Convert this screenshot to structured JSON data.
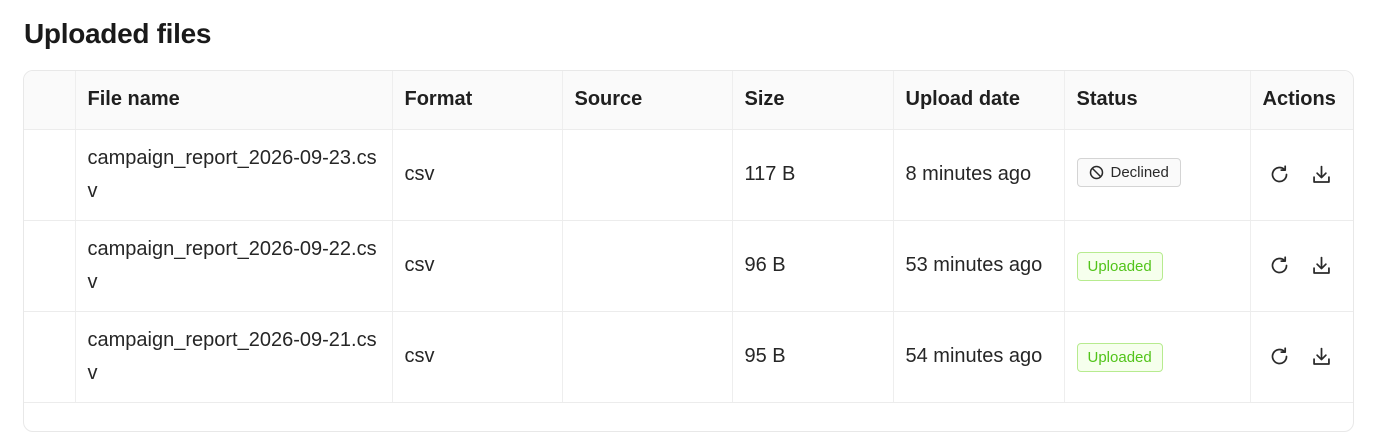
{
  "page": {
    "title": "Uploaded files"
  },
  "table": {
    "columns": [
      "",
      "File name",
      "Format",
      "Source",
      "Size",
      "Upload date",
      "Status",
      "Actions"
    ],
    "rows": [
      {
        "file_name": "campaign_report_2026-09-23.csv",
        "format": "csv",
        "source": "",
        "size": "117 B",
        "upload_date": "8 minutes ago",
        "status": "Declined",
        "status_kind": "declined"
      },
      {
        "file_name": "campaign_report_2026-09-22.csv",
        "format": "csv",
        "source": "",
        "size": "96 B",
        "upload_date": "53 minutes ago",
        "status": "Uploaded",
        "status_kind": "uploaded"
      },
      {
        "file_name": "campaign_report_2026-09-21.csv",
        "format": "csv",
        "source": "",
        "size": "95 B",
        "upload_date": "54 minutes ago",
        "status": "Uploaded",
        "status_kind": "uploaded"
      }
    ],
    "row_actions": [
      {
        "icon": "refresh-icon"
      },
      {
        "icon": "download-icon"
      }
    ]
  },
  "colors": {
    "declined_text": "#2a2a2a",
    "uploaded_text": "#52c41a",
    "uploaded_border": "#b7eb8f",
    "uploaded_bg": "#f6ffed"
  }
}
